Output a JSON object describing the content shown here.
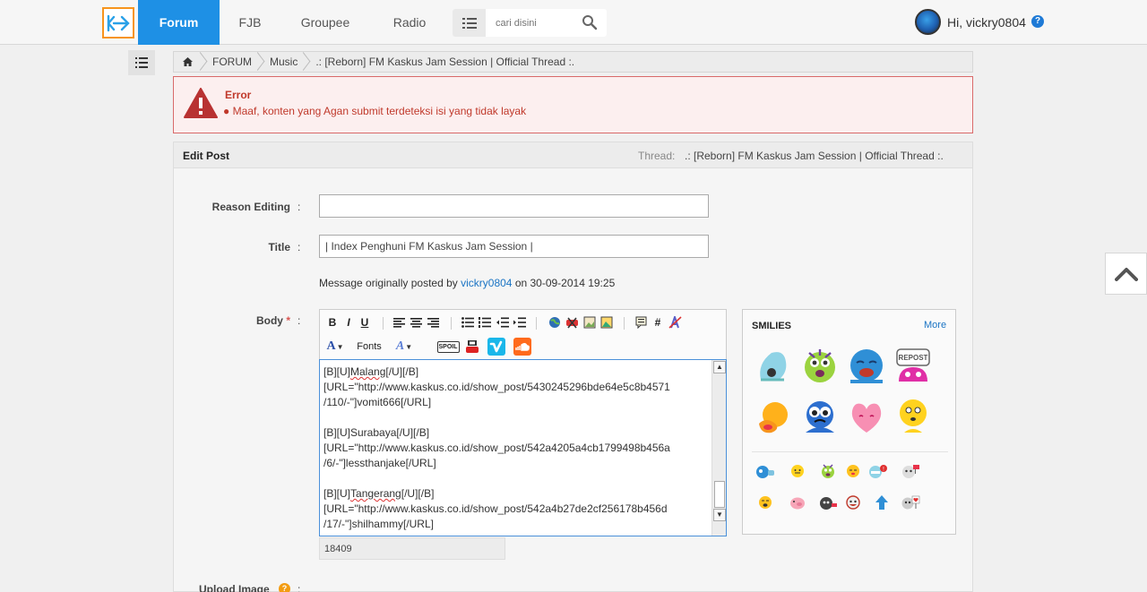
{
  "topbar": {
    "nav": [
      "Forum",
      "FJB",
      "Groupee",
      "Radio"
    ],
    "search_placeholder": "cari disini",
    "greeting": "Hi, vickry0804",
    "help_label": "?"
  },
  "breadcrumb": {
    "items": [
      "FORUM",
      "Music",
      ".: [Reborn] FM Kaskus Jam Session | Official Thread :."
    ]
  },
  "error": {
    "title": "Error",
    "message": "Maaf, konten yang Agan submit terdeteksi isi yang tidak layak"
  },
  "edit_post": {
    "heading": "Edit Post",
    "thread_label": "Thread:",
    "thread_name": ".: [Reborn] FM Kaskus Jam Session | Official Thread :.",
    "reason_label": "Reason Editing",
    "reason_value": "",
    "title_label": "Title",
    "title_value": "| Index Penghuni FM Kaskus Jam Session |",
    "original_prefix": "Message originally posted by",
    "original_user": "vickry0804",
    "original_suffix": "on 30-09-2014 19:25",
    "body_label": "Body",
    "required_mark": "*",
    "colon": ":",
    "body_lines": [
      "[B][U]Malang[/U][/B]",
      "[URL=\"http://www.kaskus.co.id/show_post/5430245296bde64e5c8b4571",
      "/110/-\"]vomit666[/URL]",
      "",
      "[B][U]Surabaya[/U][/B]",
      "[URL=\"http://www.kaskus.co.id/show_post/542a4205a4cb1799498b456a",
      "/6/-\"]lessthanjake[/URL]",
      "",
      "[B][U]Tangerang[/U][/B]",
      "[URL=\"http://www.kaskus.co.id/show_post/542a4b27de2cf256178b456d",
      "/17/-\"]shilhammy[/URL]"
    ],
    "char_count": "18409",
    "upload_label": "Upload Image",
    "upload_help": "?"
  },
  "toolbar": {
    "bold": "B",
    "italic": "I",
    "underline": "U",
    "font_color": "A",
    "fonts": "Fonts",
    "font_size": "A",
    "spoiler": "SPOIL",
    "hash": "#"
  },
  "smilies": {
    "title": "SMILIES",
    "more": "More",
    "repost": "REPOST"
  },
  "colors": {
    "accent": "#1e90e5",
    "error": "#c0392b",
    "link": "#1a74c4"
  }
}
